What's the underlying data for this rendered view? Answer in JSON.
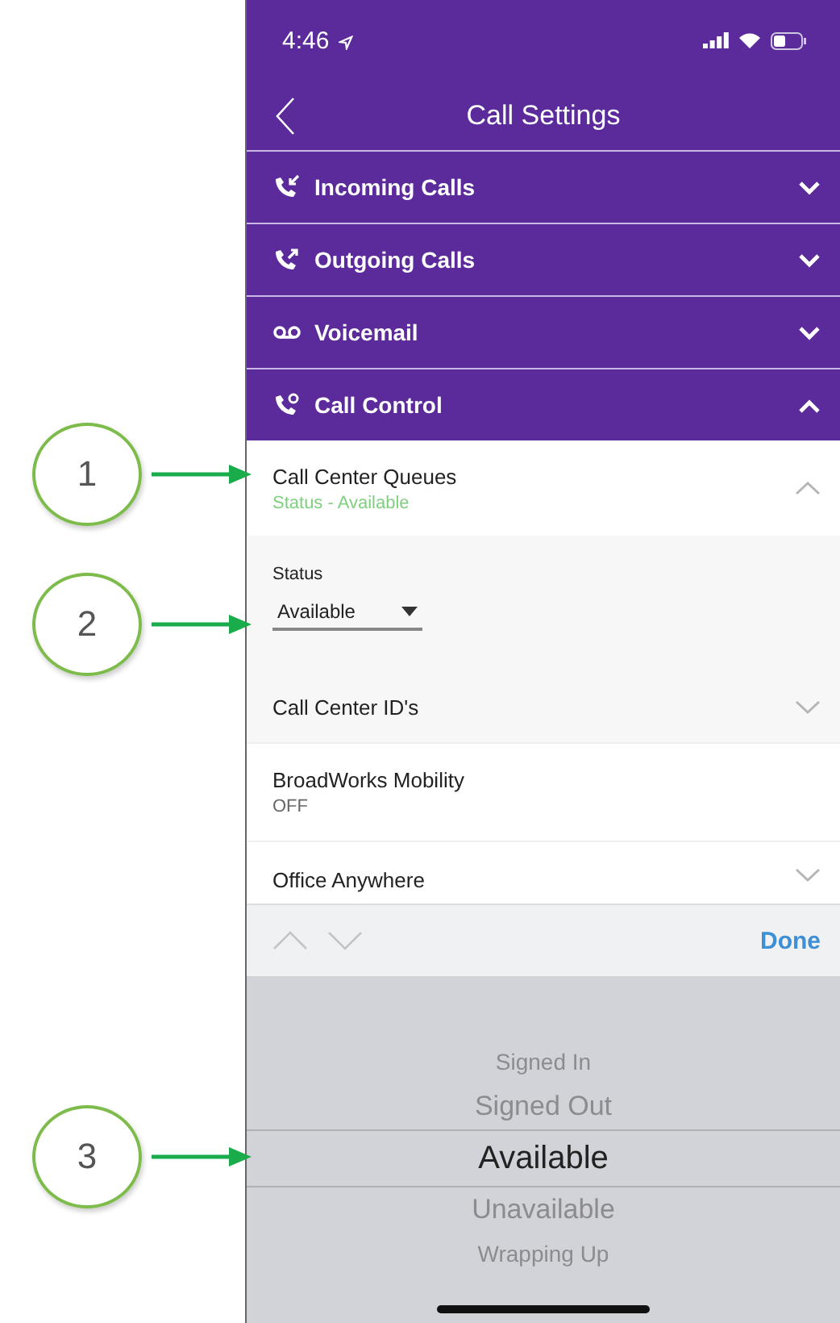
{
  "annotations": [
    {
      "number": "1"
    },
    {
      "number": "2"
    },
    {
      "number": "3"
    }
  ],
  "status_bar": {
    "time": "4:46"
  },
  "nav": {
    "title": "Call Settings"
  },
  "sections": [
    {
      "label": "Incoming Calls",
      "expanded": false
    },
    {
      "label": "Outgoing Calls",
      "expanded": false
    },
    {
      "label": "Voicemail",
      "expanded": false
    },
    {
      "label": "Call Control",
      "expanded": true
    }
  ],
  "call_control": [
    {
      "kind": "queues",
      "title": "Call Center Queues",
      "subtitle": "Status - Available",
      "expanded": true,
      "children": [
        {
          "kind": "dropdown",
          "label": "Status",
          "value": "Available"
        },
        {
          "kind": "expander",
          "title": "Call Center ID's",
          "expanded": false
        }
      ]
    },
    {
      "kind": "info",
      "title": "BroadWorks Mobility",
      "subtitle": "OFF"
    },
    {
      "kind": "expander",
      "title": "Office Anywhere",
      "expanded": false
    }
  ],
  "picker": {
    "done": "Done",
    "options": [
      {
        "label": "Signed In",
        "selected": false
      },
      {
        "label": "Signed Out",
        "selected": false
      },
      {
        "label": "Available",
        "selected": true
      },
      {
        "label": "Unavailable",
        "selected": false
      },
      {
        "label": "Wrapping Up",
        "selected": false
      }
    ]
  }
}
